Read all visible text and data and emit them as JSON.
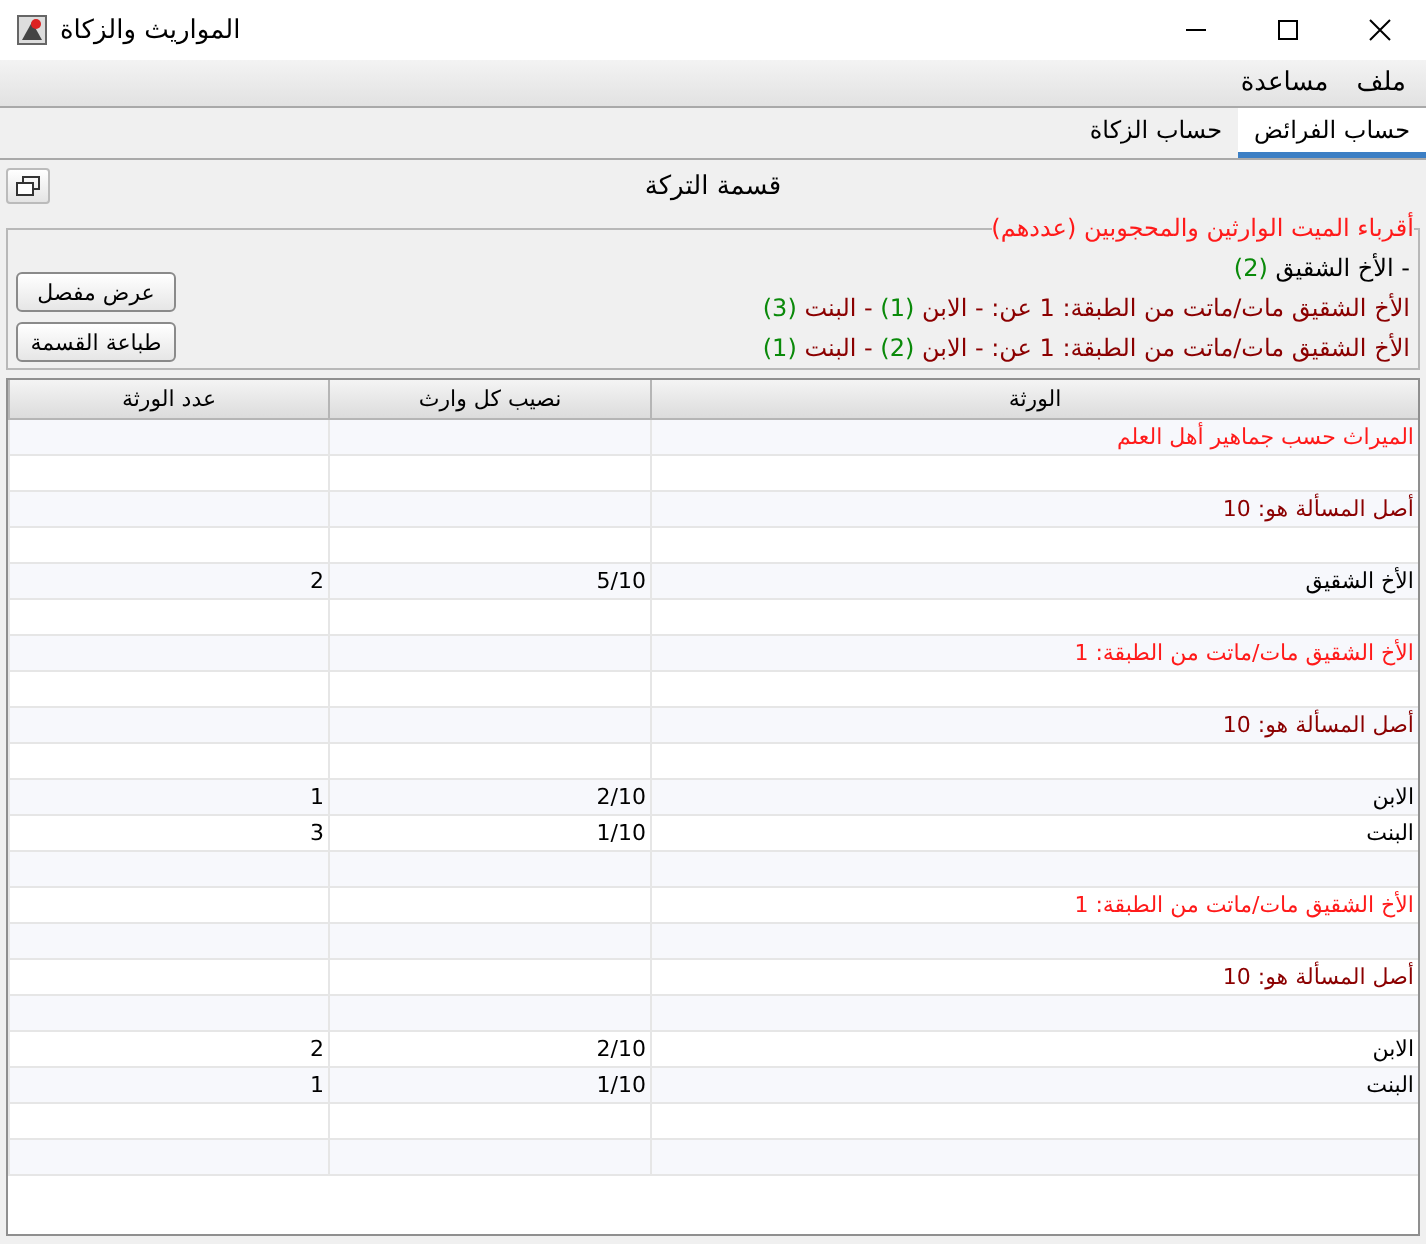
{
  "window": {
    "title": "المواريث والزكاة"
  },
  "menu": [
    {
      "label": "ملف"
    },
    {
      "label": "مساعدة"
    }
  ],
  "tabs": [
    {
      "label": "حساب الفرائض",
      "selected": true
    },
    {
      "label": "حساب الزكاة",
      "selected": false
    }
  ],
  "heading": "قسمة التركة",
  "relatives": {
    "legend": "أقرباء الميت الوارثين والمحجوبين (عددهم)",
    "lines": [
      {
        "kind": "heir",
        "parts": [
          {
            "kind": "text",
            "text": "- الأخ الشقيق "
          },
          {
            "kind": "count",
            "text": "(2)"
          }
        ]
      },
      {
        "kind": "deceased",
        "parts": [
          {
            "kind": "text",
            "text": "الأخ الشقيق مات/ماتت من الطبقة: 1 عن: - الابن "
          },
          {
            "kind": "count",
            "text": "(1)"
          },
          {
            "kind": "text",
            "text": " - البنت "
          },
          {
            "kind": "count",
            "text": "(3)"
          }
        ]
      },
      {
        "kind": "deceased",
        "parts": [
          {
            "kind": "text",
            "text": "الأخ الشقيق مات/ماتت من الطبقة: 1 عن: - الابن "
          },
          {
            "kind": "count",
            "text": "(2)"
          },
          {
            "kind": "text",
            "text": " - البنت "
          },
          {
            "kind": "count",
            "text": "(1)"
          }
        ]
      }
    ]
  },
  "buttons": [
    {
      "label": "عرض مفصل"
    },
    {
      "label": "طباعة القسمة"
    }
  ],
  "table": {
    "columns": [
      "الورثة",
      "نصيب كل وارث",
      "عدد الورثة"
    ],
    "rows": [
      {
        "kind": "heading",
        "cells": [
          "الميراث حسب جماهير أهل العلم"
        ]
      },
      {
        "kind": "blank",
        "cells": []
      },
      {
        "kind": "base",
        "cells": [
          "أصل المسألة هو: 10"
        ]
      },
      {
        "kind": "blank",
        "cells": []
      },
      {
        "kind": "heir",
        "cells": [
          "الأخ الشقيق",
          "5/10",
          "2"
        ]
      },
      {
        "kind": "blank",
        "cells": []
      },
      {
        "kind": "heading",
        "cells": [
          "الأخ الشقيق مات/ماتت من الطبقة: 1"
        ]
      },
      {
        "kind": "blank",
        "cells": []
      },
      {
        "kind": "base",
        "cells": [
          "أصل المسألة هو: 10"
        ]
      },
      {
        "kind": "blank",
        "cells": []
      },
      {
        "kind": "heir",
        "cells": [
          "الابن",
          "2/10",
          "1"
        ]
      },
      {
        "kind": "heir",
        "cells": [
          "البنت",
          "1/10",
          "3"
        ]
      },
      {
        "kind": "blank",
        "cells": []
      },
      {
        "kind": "heading",
        "cells": [
          "الأخ الشقيق مات/ماتت من الطبقة: 1"
        ]
      },
      {
        "kind": "blank",
        "cells": []
      },
      {
        "kind": "base",
        "cells": [
          "أصل المسألة هو: 10"
        ]
      },
      {
        "kind": "blank",
        "cells": []
      },
      {
        "kind": "heir",
        "cells": [
          "الابن",
          "2/10",
          "2"
        ]
      },
      {
        "kind": "heir",
        "cells": [
          "البنت",
          "1/10",
          "1"
        ]
      },
      {
        "kind": "blank",
        "cells": []
      },
      {
        "kind": "blank",
        "cells": []
      }
    ]
  }
}
